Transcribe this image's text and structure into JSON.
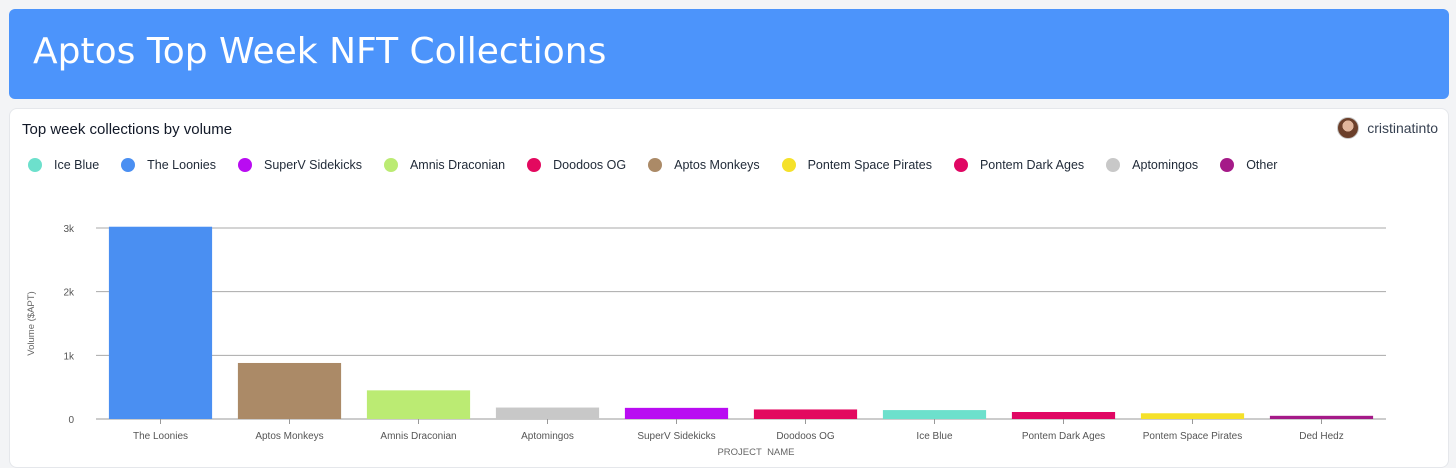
{
  "header": {
    "title": "Aptos Top Week NFT Collections"
  },
  "card": {
    "title": "Top week collections by volume",
    "author": "cristinatinto"
  },
  "legend": [
    {
      "label": "Ice Blue",
      "color": "#6de0cc"
    },
    {
      "label": "The Loonies",
      "color": "#4a8ff2"
    },
    {
      "label": "SuperV Sidekicks",
      "color": "#b90cf2"
    },
    {
      "label": "Amnis Draconian",
      "color": "#bbeb73"
    },
    {
      "label": "Doodoos OG",
      "color": "#e3095f"
    },
    {
      "label": "Aptos Monkeys",
      "color": "#ab8a67"
    },
    {
      "label": "Pontem Space Pirates",
      "color": "#f5e12a"
    },
    {
      "label": "Pontem Dark Ages",
      "color": "#e00763"
    },
    {
      "label": "Aptomingos",
      "color": "#c8c8c8"
    },
    {
      "label": "Other",
      "color": "#a51a88"
    }
  ],
  "chart_data": {
    "type": "bar",
    "categories": [
      "The Loonies",
      "Aptos Monkeys",
      "Amnis Draconian",
      "Aptomingos",
      "SuperV Sidekicks",
      "Doodoos OG",
      "Ice Blue",
      "Pontem Dark Ages",
      "Pontem Space Pirates",
      "Ded Hedz"
    ],
    "values": [
      3020,
      880,
      450,
      180,
      175,
      150,
      140,
      110,
      90,
      50
    ],
    "colors": [
      "#4a8ff2",
      "#ab8a67",
      "#bbeb73",
      "#c8c8c8",
      "#b90cf2",
      "#e3095f",
      "#6de0cc",
      "#e00763",
      "#f5e12a",
      "#a51a88"
    ],
    "xlabel": "PROJECT_NAME",
    "ylabel": "Volume ($APT)",
    "yticks": [
      0,
      1000,
      2000,
      3000
    ],
    "ytick_labels": [
      "0",
      "1k",
      "2k",
      "3k"
    ],
    "ylim": [
      0,
      3000
    ],
    "grid": true
  }
}
